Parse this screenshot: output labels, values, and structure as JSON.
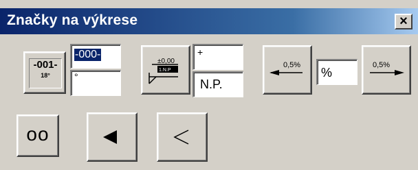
{
  "window": {
    "title": "Značky na výkrese",
    "close_label": "×"
  },
  "ozn_button": {
    "top_label": "-001-",
    "bottom_label": "18°"
  },
  "ozn_fields": {
    "text_value": "-000-",
    "angle_value": "°"
  },
  "level_button": {
    "level_text": "±0,00",
    "floor_text": "1.N.P"
  },
  "level_fields": {
    "sign_value": "+",
    "floor_value": "N.P."
  },
  "slope_left_button": {
    "label": "0,5%"
  },
  "slope_field": {
    "value": "%"
  },
  "slope_right_button": {
    "label": "0,5%"
  },
  "bottom_buttons": {
    "circles_label": "oo"
  },
  "colors": {
    "titlebar_start": "#0a246a",
    "titlebar_end": "#a6caf0",
    "face": "#d4d0c8",
    "selection": "#0a246a"
  },
  "icons": [
    "close-icon",
    "level-mark-icon",
    "slope-arrow-left-icon",
    "slope-arrow-right-icon",
    "filled-triangle-left-icon",
    "chevron-left-icon"
  ]
}
